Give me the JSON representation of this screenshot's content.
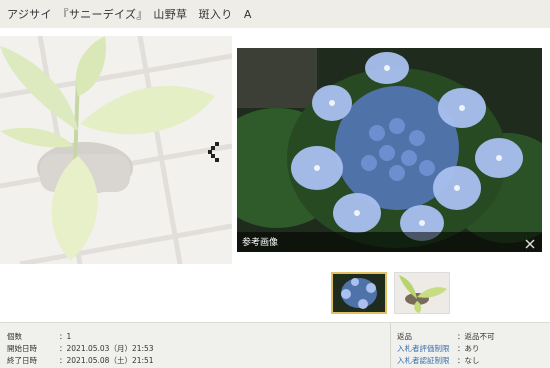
{
  "header": {
    "title": "アジサイ　『サニーデイズ』　山野草　斑入り　A"
  },
  "gallery": {
    "ref_caption": "参考画像"
  },
  "info": {
    "left": [
      {
        "label": "個数",
        "value": "：1"
      },
      {
        "label": "開始日時",
        "value": "：2021.05.03（月）21:53"
      },
      {
        "label": "終了日時",
        "value": "：2021.05.08（土）21:51"
      }
    ],
    "right": [
      {
        "label": "返品",
        "value": "：返品不可",
        "link": false
      },
      {
        "label": "入札者評価制限",
        "value": "：あり",
        "link": true
      },
      {
        "label": "入札者認証制限",
        "value": "：なし",
        "link": true
      }
    ]
  },
  "icons": {
    "prev": "chevron-left-icon",
    "close": "close-icon"
  },
  "colors": {
    "header_bg": "#eeede8",
    "info_bg": "#f0f0ec",
    "link": "#3a6fb0"
  }
}
